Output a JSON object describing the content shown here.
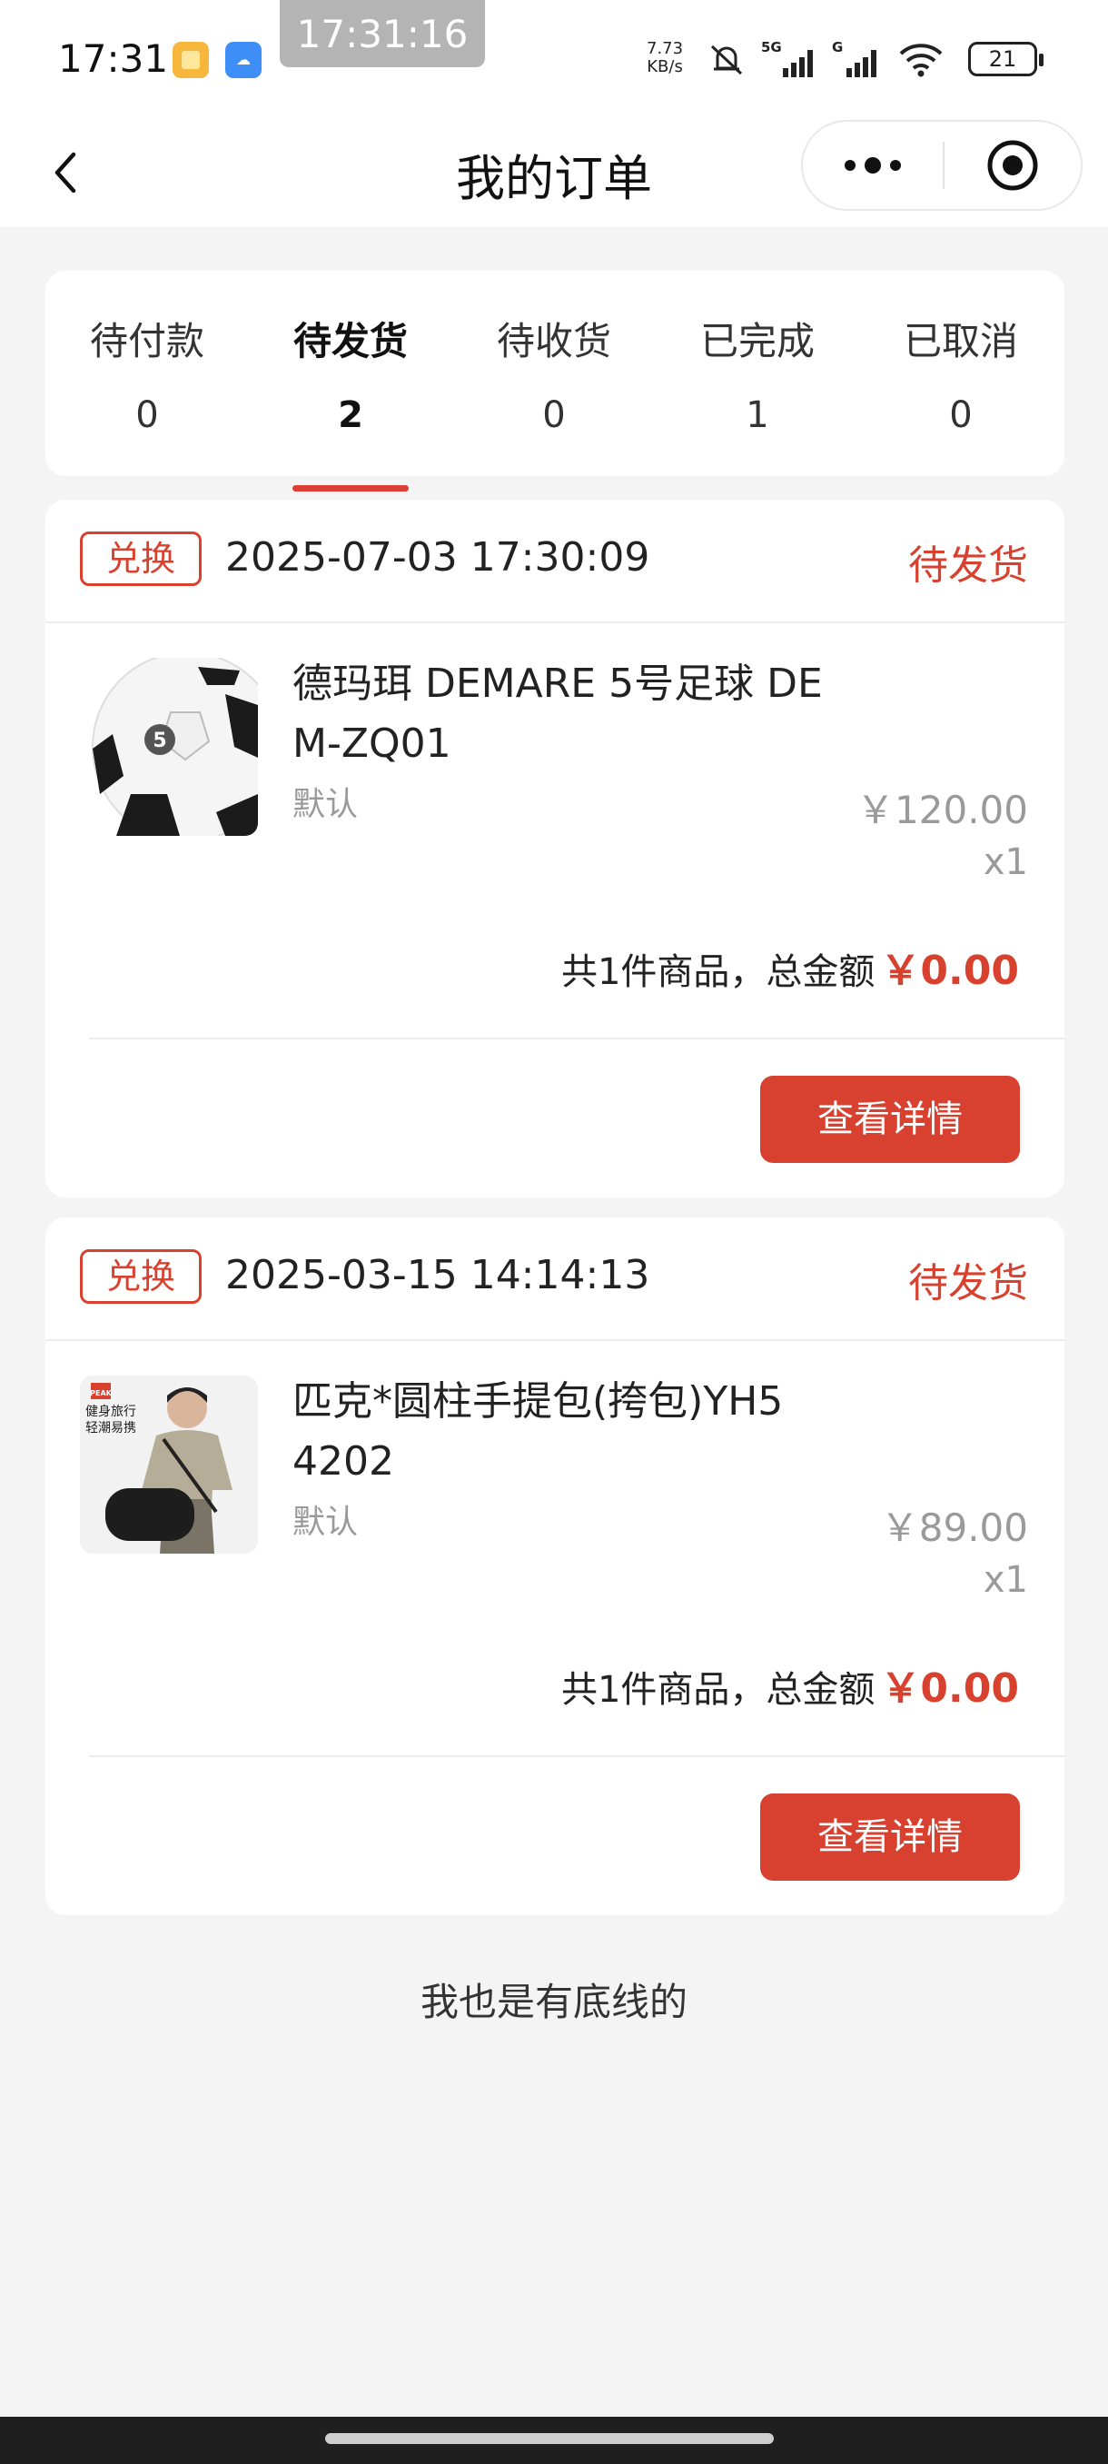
{
  "status_bar": {
    "time": "17:31",
    "screenshot_time": "17:31:16",
    "net_speed_value": "7.73",
    "net_speed_unit": "KB/s",
    "battery": "21",
    "icons": [
      "gallery-app-icon",
      "weather-app-icon",
      "mute-icon",
      "signal-5g-icon",
      "signal-g-icon",
      "wifi-icon",
      "battery-icon"
    ]
  },
  "nav": {
    "title": "我的订单",
    "icons": [
      "back-icon",
      "more-icon",
      "target-icon"
    ]
  },
  "tabs": [
    {
      "label": "待付款",
      "count": "0",
      "active": false
    },
    {
      "label": "待发货",
      "count": "2",
      "active": true
    },
    {
      "label": "待收货",
      "count": "0",
      "active": false
    },
    {
      "label": "已完成",
      "count": "1",
      "active": false
    },
    {
      "label": "已取消",
      "count": "0",
      "active": false
    }
  ],
  "orders": [
    {
      "tag": "兑换",
      "time": "2025-07-03 17:30:09",
      "status": "待发货",
      "product_name_line1": "德玛珥 DEMARE 5号足球 DE",
      "product_name_line2": "M-ZQ01",
      "spec": "默认",
      "price": "￥120.00",
      "qty": "x1",
      "summary_label": "共1件商品，总金额",
      "total": "￥0.00",
      "button": "查看详情",
      "image_icon": "soccer-ball-image"
    },
    {
      "tag": "兑换",
      "time": "2025-03-15 14:14:13",
      "status": "待发货",
      "product_name_line1": "匹克*圆柱手提包(挎包)YH5",
      "product_name_line2": "4202",
      "spec": "默认",
      "price": "￥89.00",
      "qty": "x1",
      "summary_label": "共1件商品，总金额",
      "total": "￥0.00",
      "button": "查看详情",
      "image_icon": "handbag-model-image",
      "image_brand": "PEAK",
      "image_caption_1": "健身旅行",
      "image_caption_2": "轻潮易携"
    }
  ],
  "footer_note": "我也是有底线的",
  "colors": {
    "accent": "#d9412f",
    "background": "#f4f4f5",
    "card": "#ffffff",
    "muted_text": "#9a9a9a"
  }
}
